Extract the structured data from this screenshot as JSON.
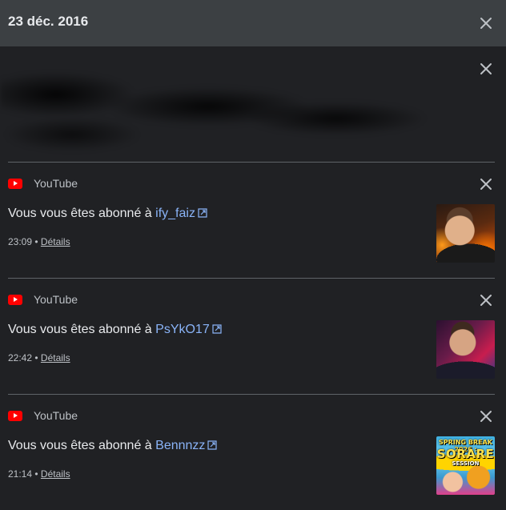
{
  "header": {
    "date": "23 déc. 2016"
  },
  "notifications": [
    {
      "app": "YouTube",
      "message_prefix": "Vous vous êtes abonné à ",
      "channel": "ify_faiz",
      "time": "23:09",
      "details_label": "Détails"
    },
    {
      "app": "YouTube",
      "message_prefix": "Vous vous êtes abonné à ",
      "channel": "PsYkO17",
      "time": "22:42",
      "details_label": "Détails"
    },
    {
      "app": "YouTube",
      "message_prefix": "Vous vous êtes abonné à ",
      "channel": "Bennnzz",
      "time": "21:14",
      "details_label": "Détails",
      "thumbnail_text": {
        "top": "SPRING BREAK 2026 :",
        "mid": "SORARE",
        "sub": "SESSION"
      }
    }
  ],
  "meta_separator": " • ",
  "colors": {
    "background": "#202124",
    "header_background": "#3c4043",
    "link": "#8ab4f8",
    "youtube_red": "#ff0000"
  },
  "icons": {
    "close": "close-icon",
    "app": "youtube-icon",
    "external": "external-link-icon"
  }
}
